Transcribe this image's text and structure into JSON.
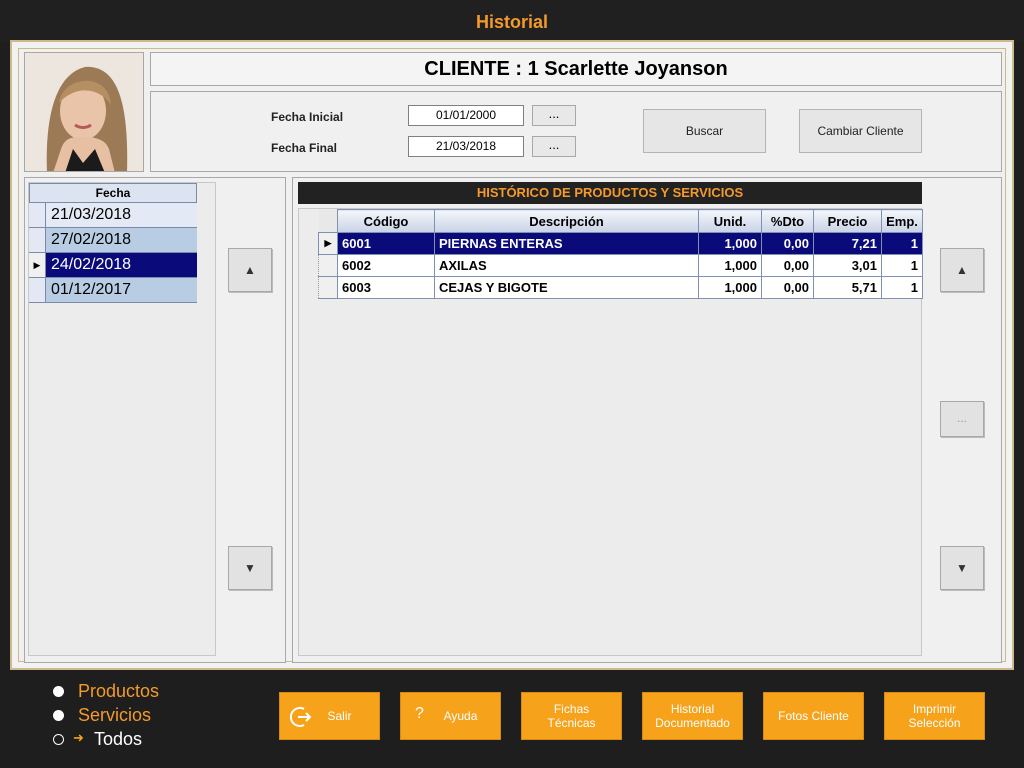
{
  "window": {
    "title": "Historial"
  },
  "client": {
    "heading": "CLIENTE : 1 Scarlette Joyanson"
  },
  "filters": {
    "fecha_inicial_label": "Fecha Inicial",
    "fecha_inicial_value": "01/01/2000",
    "fecha_final_label": "Fecha Final",
    "fecha_final_value": "21/03/2018",
    "dots_label": "..."
  },
  "buttons": {
    "buscar": "Buscar",
    "cambiar_cliente": "Cambiar Cliente",
    "ellipsis": "..."
  },
  "dates": {
    "header": "Fecha",
    "rows": [
      "21/03/2018",
      "27/02/2018",
      "24/02/2018",
      "01/12/2017"
    ],
    "selected_index": 2
  },
  "products": {
    "title": "HISTÓRICO DE PRODUCTOS Y SERVICIOS",
    "columns": [
      "Código",
      "Descripción",
      "Unid.",
      "%Dto",
      "Precio",
      "Emp."
    ],
    "rows": [
      [
        "6001",
        "PIERNAS ENTERAS",
        "1,000",
        "0,00",
        "7,21",
        "1"
      ],
      [
        "6002",
        "AXILAS",
        "1,000",
        "0,00",
        "3,01",
        "1"
      ],
      [
        "6003",
        "CEJAS Y BIGOTE",
        "1,000",
        "0,00",
        "5,71",
        "1"
      ]
    ],
    "selected_index": 0
  },
  "filter_options": {
    "productos": "Productos",
    "servicios": "Servicios",
    "todos": "Todos",
    "selected": "Todos"
  },
  "bottom_buttons": {
    "salir": "Salir",
    "ayuda": "Ayuda",
    "ayuda_icon": "?",
    "fichas_1": "Fichas",
    "fichas_2": "Técnicas",
    "historial_1": "Historial",
    "historial_2": "Documentado",
    "fotos": "Fotos Cliente",
    "imprimir_1": "Imprimir",
    "imprimir_2": "Selección"
  },
  "colors": {
    "accent": "#f39a2b",
    "button": "#f7a21b",
    "selection": "#0a0a7a"
  },
  "icons": [
    "arrow-up-icon",
    "arrow-down-icon",
    "exit-icon",
    "help-icon",
    "row-pointer-icon",
    "double-arrow-icon"
  ]
}
